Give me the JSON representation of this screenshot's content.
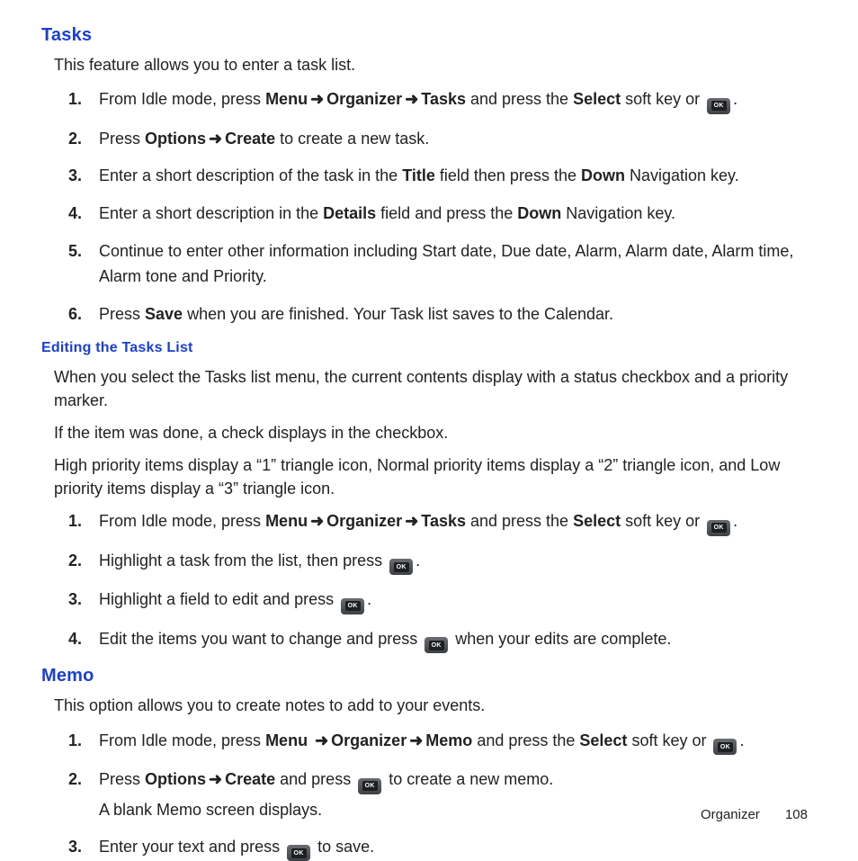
{
  "tasks": {
    "heading": "Tasks",
    "intro": "This feature allows you to enter a task list.",
    "steps": {
      "s1": {
        "a": "From Idle mode, press ",
        "menu": "Menu",
        "organizer": "Organizer",
        "tasks": "Tasks",
        "b": " and press the ",
        "select": "Select",
        "c": " soft key or ",
        "d": "."
      },
      "s2": {
        "a": "Press ",
        "options": "Options",
        "create": "Create",
        "b": " to create a new task."
      },
      "s3": {
        "a": "Enter a short description of the task in the ",
        "title": "Title",
        "b": " field then press the ",
        "down": "Down",
        "c": " Navigation key."
      },
      "s4": {
        "a": "Enter a short description in the ",
        "details": "Details",
        "b": " field and press the ",
        "down": "Down",
        "c": " Navigation key."
      },
      "s5": "Continue to enter other information including Start date, Due date, Alarm, Alarm date, Alarm time, Alarm tone and Priority.",
      "s6": {
        "a": "Press ",
        "save": "Save",
        "b": " when you are finished. Your Task list saves to the Calendar."
      }
    }
  },
  "editing": {
    "heading": "Editing the Tasks List",
    "p1": "When you select the Tasks list menu, the current contents display with a status checkbox and a priority marker.",
    "p2": "If the item was done, a check displays in the checkbox.",
    "p3": "High priority items display a “1” triangle icon, Normal priority items display a “2” triangle icon, and Low priority items display a “3” triangle icon.",
    "steps": {
      "s1": {
        "a": "From Idle mode, press ",
        "menu": "Menu",
        "organizer": "Organizer",
        "tasks": "Tasks",
        "b": " and press the ",
        "select": "Select",
        "c": " soft key or ",
        "d": "."
      },
      "s2": {
        "a": "Highlight a task from the list, then press ",
        "b": "."
      },
      "s3": {
        "a": "Highlight a field to edit and press ",
        "b": "."
      },
      "s4": {
        "a": "Edit the items you want to change and press ",
        "b": " when your edits are complete."
      }
    }
  },
  "memo": {
    "heading": "Memo",
    "intro": "This option allows you to create notes to add to your events.",
    "steps": {
      "s1": {
        "a": "From Idle mode, press ",
        "menu": "Menu",
        "organizer": "Organizer",
        "memo": "Memo",
        "b": " and press the ",
        "select": "Select",
        "c": " soft key or ",
        "d": "."
      },
      "s2": {
        "a": "Press ",
        "options": "Options",
        "create": "Create",
        "b": " and press ",
        "c": " to create a new memo.",
        "sub": "A blank Memo screen displays."
      },
      "s3": {
        "a": "Enter your text and press ",
        "b": " to save."
      }
    }
  },
  "footer": {
    "section": "Organizer",
    "page": "108"
  },
  "arrow": "➜",
  "ok_label": "OK"
}
